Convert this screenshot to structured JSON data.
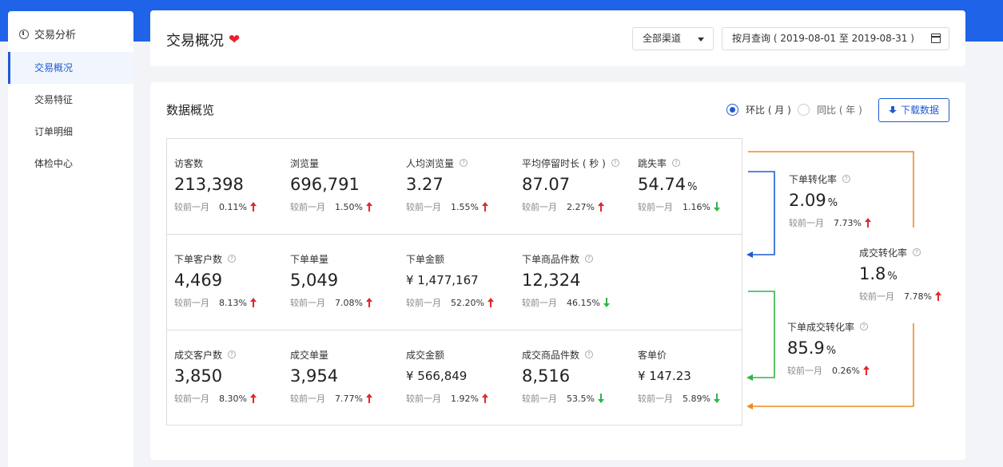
{
  "sidebar": {
    "title": "交易分析",
    "items": [
      {
        "label": "交易概况",
        "active": true
      },
      {
        "label": "交易特征",
        "active": false
      },
      {
        "label": "订单明细",
        "active": false
      },
      {
        "label": "体检中心",
        "active": false
      }
    ]
  },
  "header": {
    "title": "交易概况",
    "channel_select": "全部渠道",
    "date_range": "按月查询 ( 2019-08-01 至 2019-08-31 )"
  },
  "overview": {
    "title": "数据概览",
    "radio_mom": "环比 ( 月 )",
    "radio_yoy": "同比 ( 年 )",
    "download_label": "下载数据",
    "compare_label": "较前一月",
    "row1": [
      {
        "label": "访客数",
        "value": "213,398",
        "pct": "0.11%",
        "trend": "up",
        "help": false
      },
      {
        "label": "浏览量",
        "value": "696,791",
        "pct": "1.50%",
        "trend": "up",
        "help": false
      },
      {
        "label": "人均浏览量",
        "value": "3.27",
        "pct": "1.55%",
        "trend": "up",
        "help": true
      },
      {
        "label": "平均停留时长 ( 秒 )",
        "value": "87.07",
        "pct": "2.27%",
        "trend": "up",
        "help": true
      },
      {
        "label": "跳失率",
        "value": "54.74",
        "unit": "%",
        "pct": "1.16%",
        "trend": "down",
        "help": true
      }
    ],
    "row2": [
      {
        "label": "下单客户数",
        "value": "4,469",
        "pct": "8.13%",
        "trend": "up",
        "help": true
      },
      {
        "label": "下单单量",
        "value": "5,049",
        "pct": "7.08%",
        "trend": "up",
        "help": false
      },
      {
        "label": "下单金额",
        "value": "¥ 1,477,167",
        "pct": "52.20%",
        "trend": "up",
        "help": false
      },
      {
        "label": "下单商品件数",
        "value": "12,324",
        "pct": "46.15%",
        "trend": "down",
        "help": true
      }
    ],
    "row3": [
      {
        "label": "成交客户数",
        "value": "3,850",
        "pct": "8.30%",
        "trend": "up",
        "help": true
      },
      {
        "label": "成交单量",
        "value": "3,954",
        "pct": "7.77%",
        "trend": "up",
        "help": false
      },
      {
        "label": "成交金额",
        "value": "¥ 566,849",
        "pct": "1.92%",
        "trend": "up",
        "help": false
      },
      {
        "label": "成交商品件数",
        "value": "8,516",
        "pct": "53.5%",
        "trend": "down",
        "help": true
      },
      {
        "label": "客单价",
        "value": "¥ 147.23",
        "pct": "5.89%",
        "trend": "down",
        "help": false
      }
    ],
    "conversion": [
      {
        "label": "下单转化率",
        "value": "2.09",
        "unit": "%",
        "pct": "7.73%",
        "trend": "up"
      },
      {
        "label": "成交转化率",
        "value": "1.8",
        "unit": "%",
        "pct": "7.78%",
        "trend": "up"
      },
      {
        "label": "下单成交转化率",
        "value": "85.9",
        "unit": "%",
        "pct": "0.26%",
        "trend": "up"
      }
    ]
  },
  "colors": {
    "brand": "#1e63e8",
    "up": "#e5262b",
    "down": "#2fb544",
    "flow_blue": "#1e5ad6",
    "flow_green": "#2fb544",
    "flow_orange": "#f08a24"
  }
}
